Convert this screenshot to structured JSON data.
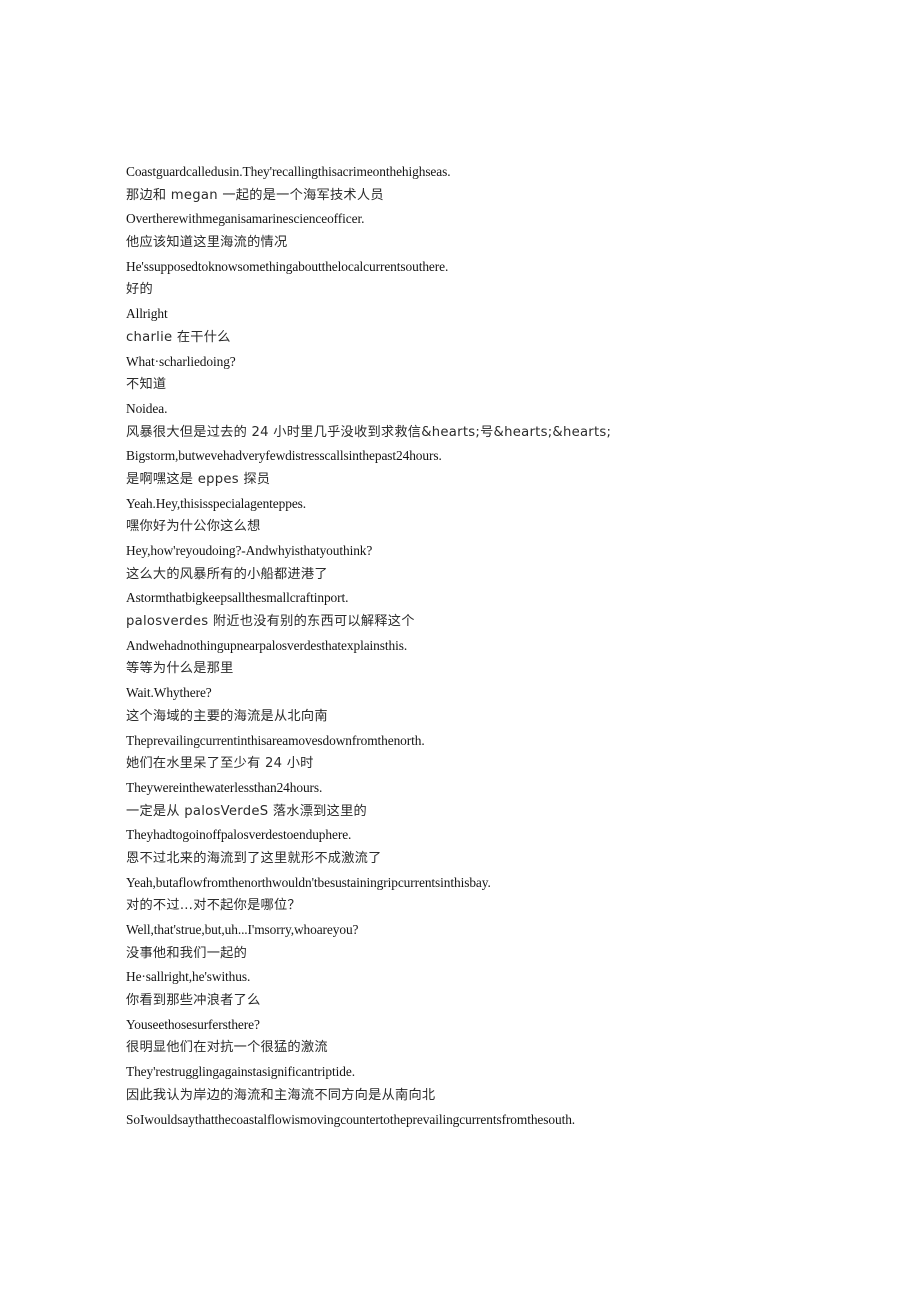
{
  "document": {
    "type": "bilingual-subtitle-transcript",
    "background_color": "#ffffff",
    "text_color": "#1a1a1a",
    "lines": [
      {
        "lang": "en",
        "text": "Coastguardcalledusin.They'recallingthisacrimeonthehighseas."
      },
      {
        "lang": "zh",
        "text": "那边和 megan 一起的是一个海军技术人员"
      },
      {
        "lang": "en",
        "text": "Overtherewithmeganisamarinescienceofficer."
      },
      {
        "lang": "zh",
        "text": "他应该知道这里海流的情况"
      },
      {
        "lang": "en",
        "text": "He'ssupposedtoknowsomethingaboutthelocalcurrentsouthere."
      },
      {
        "lang": "zh",
        "text": "好的"
      },
      {
        "lang": "en",
        "text": "Allright"
      },
      {
        "lang": "zh",
        "text": "charlie 在干什么"
      },
      {
        "lang": "en",
        "text": "What·scharliedoing?"
      },
      {
        "lang": "zh",
        "text": "不知道"
      },
      {
        "lang": "en",
        "text": "Noidea."
      },
      {
        "lang": "zh",
        "text": "风暴很大但是过去的 24 小时里几乎没收到求救信&hearts;号&hearts;&hearts;"
      },
      {
        "lang": "en",
        "text": "Bigstorm,butwevehadveryfewdistresscallsinthepast24hours."
      },
      {
        "lang": "zh",
        "text": "是啊嘿这是 eppes 探员"
      },
      {
        "lang": "en",
        "text": "Yeah.Hey,thisisspecialagenteppes."
      },
      {
        "lang": "zh",
        "text": "嘿你好为什公你这么想"
      },
      {
        "lang": "en",
        "text": "Hey,how'reyoudoing?-Andwhyisthatyouthink?"
      },
      {
        "lang": "zh",
        "text": "这么大的风暴所有的小船都进港了"
      },
      {
        "lang": "en",
        "text": "Astormthatbigkeepsallthesmallcraftinport."
      },
      {
        "lang": "zh",
        "text": "palosverdes 附近也没有别的东西可以解释这个"
      },
      {
        "lang": "en",
        "text": "Andwehadnothingupnearpalosverdesthatexplainsthis."
      },
      {
        "lang": "zh",
        "text": "等等为什么是那里"
      },
      {
        "lang": "en",
        "text": "Wait.Whythere?"
      },
      {
        "lang": "zh",
        "text": "这个海域的主要的海流是从北向南"
      },
      {
        "lang": "en",
        "text": "Theprevailingcurrentinthisareamovesdownfromthenorth."
      },
      {
        "lang": "zh",
        "text": "她们在水里呆了至少有 24 小时"
      },
      {
        "lang": "en",
        "text": "Theywereinthewaterlessthan24hours."
      },
      {
        "lang": "zh",
        "text": "一定是从 palosVerdeS 落水漂到这里的"
      },
      {
        "lang": "en",
        "text": "Theyhadtogoinoffpalosverdestoenduphere."
      },
      {
        "lang": "zh",
        "text": "恩不过北来的海流到了这里就形不成激流了"
      },
      {
        "lang": "en",
        "text": "Yeah,butaflowfromthenorthwouldn'tbesustainingripcurrentsinthisbay."
      },
      {
        "lang": "zh",
        "text": "对的不过…对不起你是哪位？"
      },
      {
        "lang": "en",
        "text": "Well,that'strue,but,uh...I'msorry,whoareyou?"
      },
      {
        "lang": "zh",
        "text": "没事他和我们一起的"
      },
      {
        "lang": "en",
        "text": "He·sallright,he'swithus."
      },
      {
        "lang": "zh",
        "text": "你看到那些冲浪者了么"
      },
      {
        "lang": "en",
        "text": "Youseethosesurfersthere?"
      },
      {
        "lang": "zh",
        "text": "很明显他们在对抗一个很猛的激流"
      },
      {
        "lang": "en",
        "text": "They'restrugglingagainstasignificantriptide."
      },
      {
        "lang": "zh",
        "text": "因此我认为岸边的海流和主海流不同方向是从南向北"
      },
      {
        "lang": "en",
        "text": "SoIwouldsaythatthecoastalflowismovingcountertotheprevailingcurrentsfromthesouth."
      }
    ]
  }
}
